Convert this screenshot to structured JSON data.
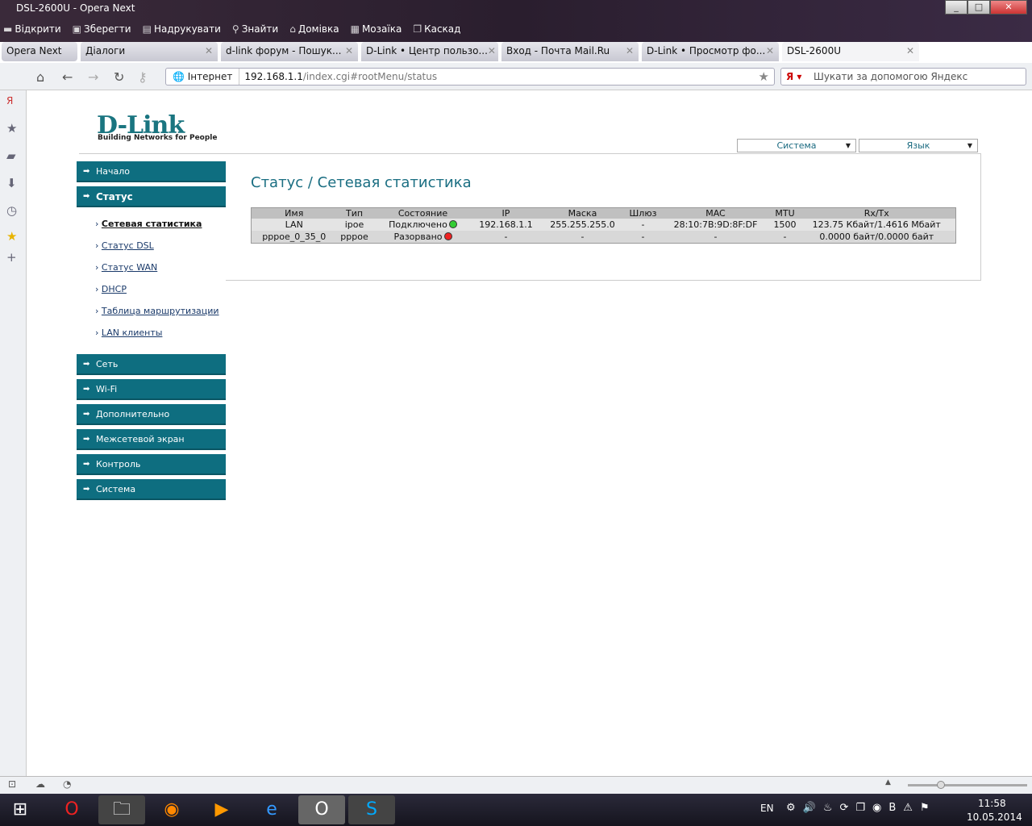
{
  "window": {
    "title": "DSL-2600U - Opera Next"
  },
  "menubar": [
    {
      "icon": "folder-icon",
      "label": "Відкрити"
    },
    {
      "icon": "save-icon",
      "label": "Зберегти"
    },
    {
      "icon": "printer-icon",
      "label": "Надрукувати"
    },
    {
      "icon": "search-icon",
      "label": "Знайти"
    },
    {
      "icon": "home-icon",
      "label": "Домівка"
    },
    {
      "icon": "tile-icon",
      "label": "Мозаїка"
    },
    {
      "icon": "cascade-icon",
      "label": "Каскад"
    }
  ],
  "tabs": [
    {
      "label": "Opera Next"
    },
    {
      "label": "Діалоги"
    },
    {
      "label": "d-link форум - Пошук..."
    },
    {
      "label": "D-Link • Центр пользо..."
    },
    {
      "label": "Вход - Почта Mail.Ru"
    },
    {
      "label": "D-Link • Просмотр фо..."
    },
    {
      "label": "DSL-2600U"
    }
  ],
  "address": {
    "site_label": "Інтернет",
    "host": "192.168.1.1",
    "path": "/index.cgi#rootMenu/status",
    "search_placeholder": "Шукати за допомогою Яндекс"
  },
  "router": {
    "logo": "D-Link",
    "tagline": "Building Networks for People",
    "select_system": "Система",
    "select_language": "Язык",
    "menu": [
      "Начало",
      "Статус",
      "Сеть",
      "Wi-Fi",
      "Дополнительно",
      "Межсетевой экран",
      "Контроль",
      "Система"
    ],
    "submenu": [
      "Сетевая статистика",
      "Статус DSL",
      "Статус WAN",
      "DHCP",
      "Таблица маршрутизации",
      "LAN клиенты"
    ],
    "page_title": "Статус / Сетевая статистика",
    "table": {
      "headers": [
        "Имя",
        "Тип",
        "Состояние",
        "IP",
        "Маска",
        "Шлюз",
        "MAC",
        "MTU",
        "Rx/Tx"
      ],
      "rows": [
        [
          "LAN",
          "ipoe",
          "Подключено",
          "192.168.1.1",
          "255.255.255.0",
          "-",
          "28:10:7B:9D:8F:DF",
          "1500",
          "123.75 Кбайт/1.4616 Мбайт"
        ],
        [
          "pppoe_0_35_0",
          "pppoe",
          "Разорвано",
          "-",
          "-",
          "-",
          "-",
          "-",
          "0.0000 байт/0.0000 байт"
        ]
      ]
    },
    "status_colors": [
      "#33cc33",
      "#ee2222"
    ]
  },
  "taskbar": {
    "lang": "EN",
    "time": "11:58",
    "date": "10.05.2014"
  }
}
